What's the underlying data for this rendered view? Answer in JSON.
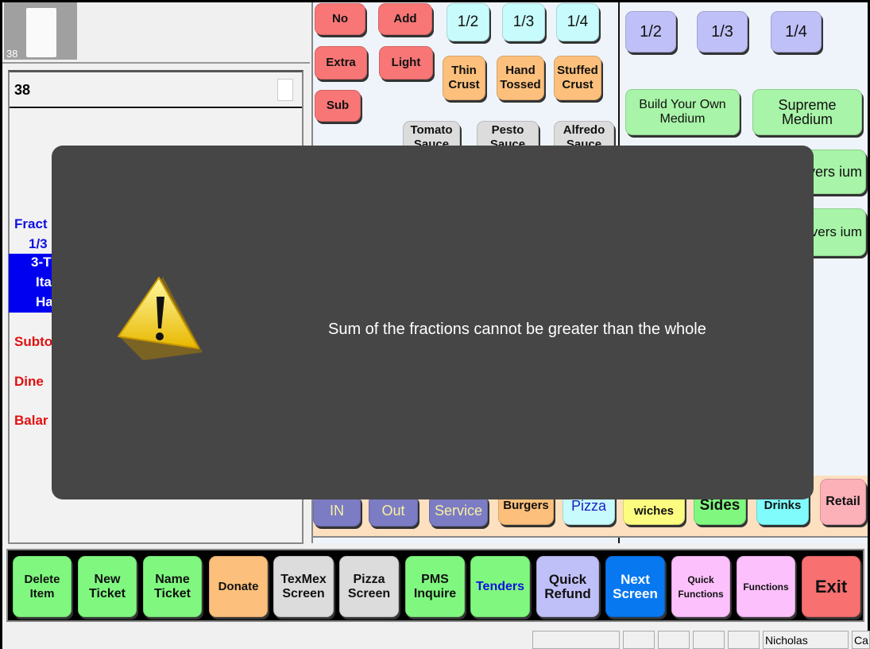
{
  "ticket": {
    "thumb_number": "38",
    "number": "38"
  },
  "ticket_lines": {
    "fraction": "Fract",
    "fraction_value": "1/3",
    "item1": "3-T",
    "item2": "Ita",
    "item3": "Ha",
    "subtotal": "Subto",
    "dine": "Dine",
    "balance": "Balar"
  },
  "modifiers": {
    "no": "No",
    "add": "Add",
    "extra": "Extra",
    "light": "Light",
    "sub": "Sub",
    "half": "1/2",
    "third": "1/3",
    "quarter": "1/4",
    "thin": "Thin Crust",
    "hand": "Hand Tossed",
    "stuffed": "Stuffed Crust",
    "tomato": "Tomato Sauce",
    "pesto": "Pesto Sauce",
    "alfredo": "Alfredo Sauce"
  },
  "pizzas": {
    "half": "1/2",
    "third": "1/3",
    "quarter": "1/4",
    "byo": "Build Your Own Medium",
    "supreme": "Supreme Medium",
    "lovers1": "Lovers ium",
    "lovers2": "Lovers ium"
  },
  "categories": {
    "in": "IN",
    "out": "Out",
    "service": "Service",
    "burgers": "Burgers",
    "pizza": "Pizza",
    "wiches": "wiches",
    "sides": "Sides",
    "drinks": "Drinks",
    "retail": "Retail"
  },
  "toolbar": {
    "delete": "Delete Item",
    "new": "New Ticket",
    "name": "Name Ticket",
    "donate": "Donate",
    "texmex": "TexMex Screen",
    "pizza": "Pizza Screen",
    "pms": "PMS Inquire",
    "tenders": "Tenders",
    "refund": "Quick Refund",
    "next": "Next Screen",
    "quickfn": "Quick Functions",
    "functions": "Functions",
    "exit": "Exit"
  },
  "status": {
    "user": "Nicholas",
    "extra": "Ca"
  },
  "dialog": {
    "message": "Sum of the fractions cannot be greater than the whole",
    "icon": "warning-icon"
  }
}
